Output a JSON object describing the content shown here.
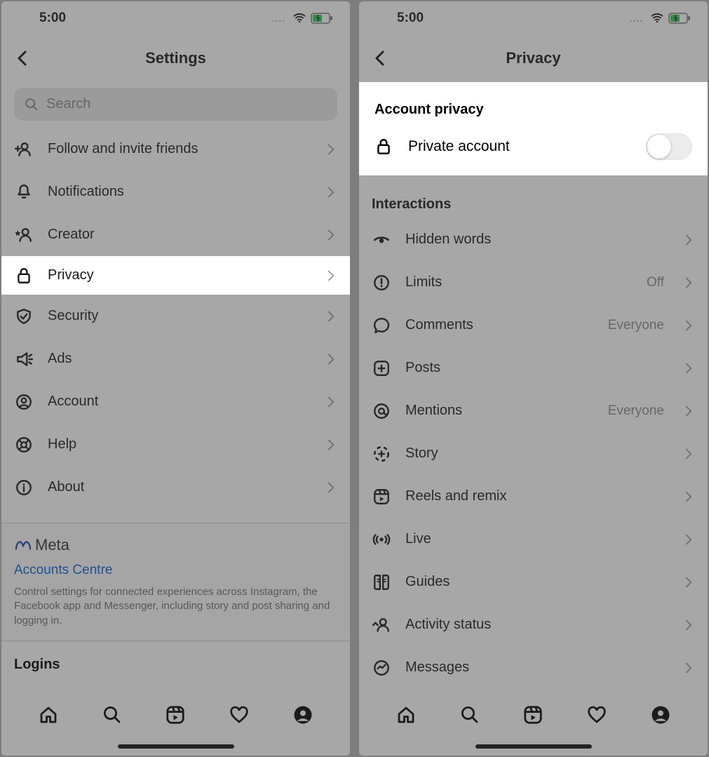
{
  "status": {
    "time": "5:00"
  },
  "left": {
    "title": "Settings",
    "search_placeholder": "Search",
    "items": [
      {
        "label": "Follow and invite friends"
      },
      {
        "label": "Notifications"
      },
      {
        "label": "Creator"
      },
      {
        "label": "Privacy"
      },
      {
        "label": "Security"
      },
      {
        "label": "Ads"
      },
      {
        "label": "Account"
      },
      {
        "label": "Help"
      },
      {
        "label": "About"
      }
    ],
    "meta": {
      "brand": "Meta",
      "accounts_centre": "Accounts Centre",
      "description": "Control settings for connected experiences across Instagram, the Facebook app and Messenger, including story and post sharing and logging in."
    },
    "logins_heading": "Logins"
  },
  "right": {
    "title": "Privacy",
    "account_privacy": {
      "heading": "Account privacy",
      "private_label": "Private account",
      "private_on": false
    },
    "interactions_heading": "Interactions",
    "items": [
      {
        "label": "Hidden words",
        "detail": ""
      },
      {
        "label": "Limits",
        "detail": "Off"
      },
      {
        "label": "Comments",
        "detail": "Everyone"
      },
      {
        "label": "Posts",
        "detail": ""
      },
      {
        "label": "Mentions",
        "detail": "Everyone"
      },
      {
        "label": "Story",
        "detail": ""
      },
      {
        "label": "Reels and remix",
        "detail": ""
      },
      {
        "label": "Live",
        "detail": ""
      },
      {
        "label": "Guides",
        "detail": ""
      },
      {
        "label": "Activity status",
        "detail": ""
      },
      {
        "label": "Messages",
        "detail": ""
      }
    ]
  }
}
